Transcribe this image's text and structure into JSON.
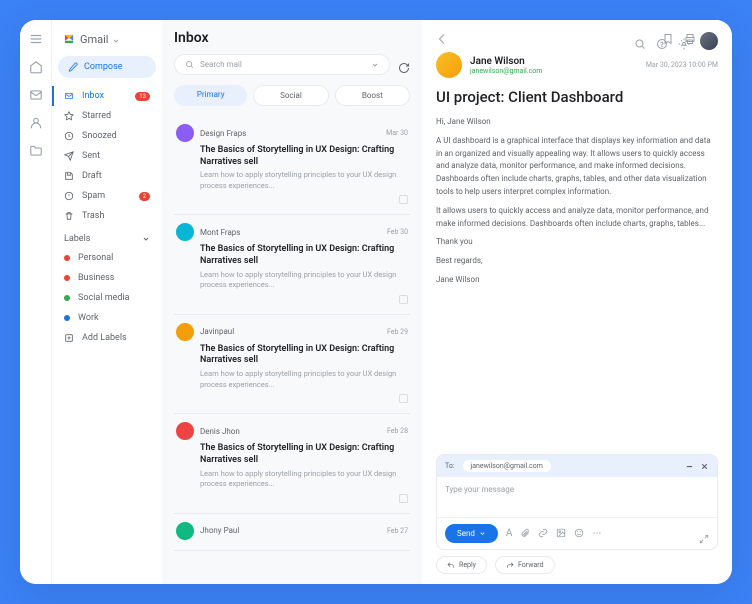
{
  "brand": "Gmail",
  "compose": "Compose",
  "nav": [
    {
      "label": "Inbox",
      "badge": "13"
    },
    {
      "label": "Starred"
    },
    {
      "label": "Snoozed"
    },
    {
      "label": "Sent"
    },
    {
      "label": "Draft"
    },
    {
      "label": "Spam",
      "badge": "2"
    },
    {
      "label": "Trash"
    }
  ],
  "labels_header": "Labels",
  "labels": [
    {
      "label": "Personal",
      "color": "#ea4335"
    },
    {
      "label": "Business",
      "color": "#ea4335"
    },
    {
      "label": "Social media",
      "color": "#34a853"
    },
    {
      "label": "Work",
      "color": "#1a73e8"
    }
  ],
  "add_labels": "Add Labels",
  "list_title": "Inbox",
  "search_placeholder": "Search mail",
  "tabs": [
    "Primary",
    "Social",
    "Boost"
  ],
  "mails": [
    {
      "sender": "Design Fraps",
      "date": "Mar 30",
      "subject": "The Basics of Storytelling in UX Design: Crafting Narratives sell",
      "preview": "Learn how to apply storytelling principles to your UX design process experiences...",
      "avatar": "#8b5cf6"
    },
    {
      "sender": "Mont Fraps",
      "date": "Feb 30",
      "subject": "The Basics of Storytelling in UX Design: Crafting Narratives sell",
      "preview": "Learn how to apply storytelling principles to your UX design process experiences...",
      "avatar": "#06b6d4"
    },
    {
      "sender": "Javinpaul",
      "date": "Feb 29",
      "subject": "The Basics of Storytelling in UX Design: Crafting Narratives sell",
      "preview": "Learn how to apply storytelling principles to your UX design process experiences...",
      "avatar": "#f59e0b"
    },
    {
      "sender": "Denis Jhon",
      "date": "Feb 28",
      "subject": "The Basics of Storytelling in UX Design: Crafting Narratives sell",
      "preview": "Learn how to apply storytelling principles to your UX design process experiences...",
      "avatar": "#ef4444"
    },
    {
      "sender": "Jhony Paul",
      "date": "Feb 27",
      "subject": "",
      "preview": "",
      "avatar": "#10b981"
    }
  ],
  "detail": {
    "from_name": "Jane Wilson",
    "from_email": "janewilson@gmail.com",
    "date": "Mar 30, 2023  10:00 PM",
    "subject": "UI project: Client Dashboard",
    "greeting": "Hi, Jane Wilson",
    "p1": "A UI dashboard is a graphical interface that displays key information and data in an organized and visually appealing way. It allows users to quickly access and analyze data, monitor performance, and make informed decisions. Dashboards often include charts, graphs, tables, and other data visualization tools to help users interpret complex information.",
    "p2": "It allows users to quickly access and analyze data, monitor performance, and make informed decisions. Dashboards often include charts, graphs, tables...",
    "thanks": "Thank you",
    "regards": "Best regards,",
    "sig": "Jane Wilson"
  },
  "reply": {
    "to_label": "To:",
    "to_value": "janewilson@gmail.com",
    "placeholder": "Type your message",
    "send": "Send"
  },
  "actions": {
    "reply": "Reply",
    "forward": "Forward"
  }
}
